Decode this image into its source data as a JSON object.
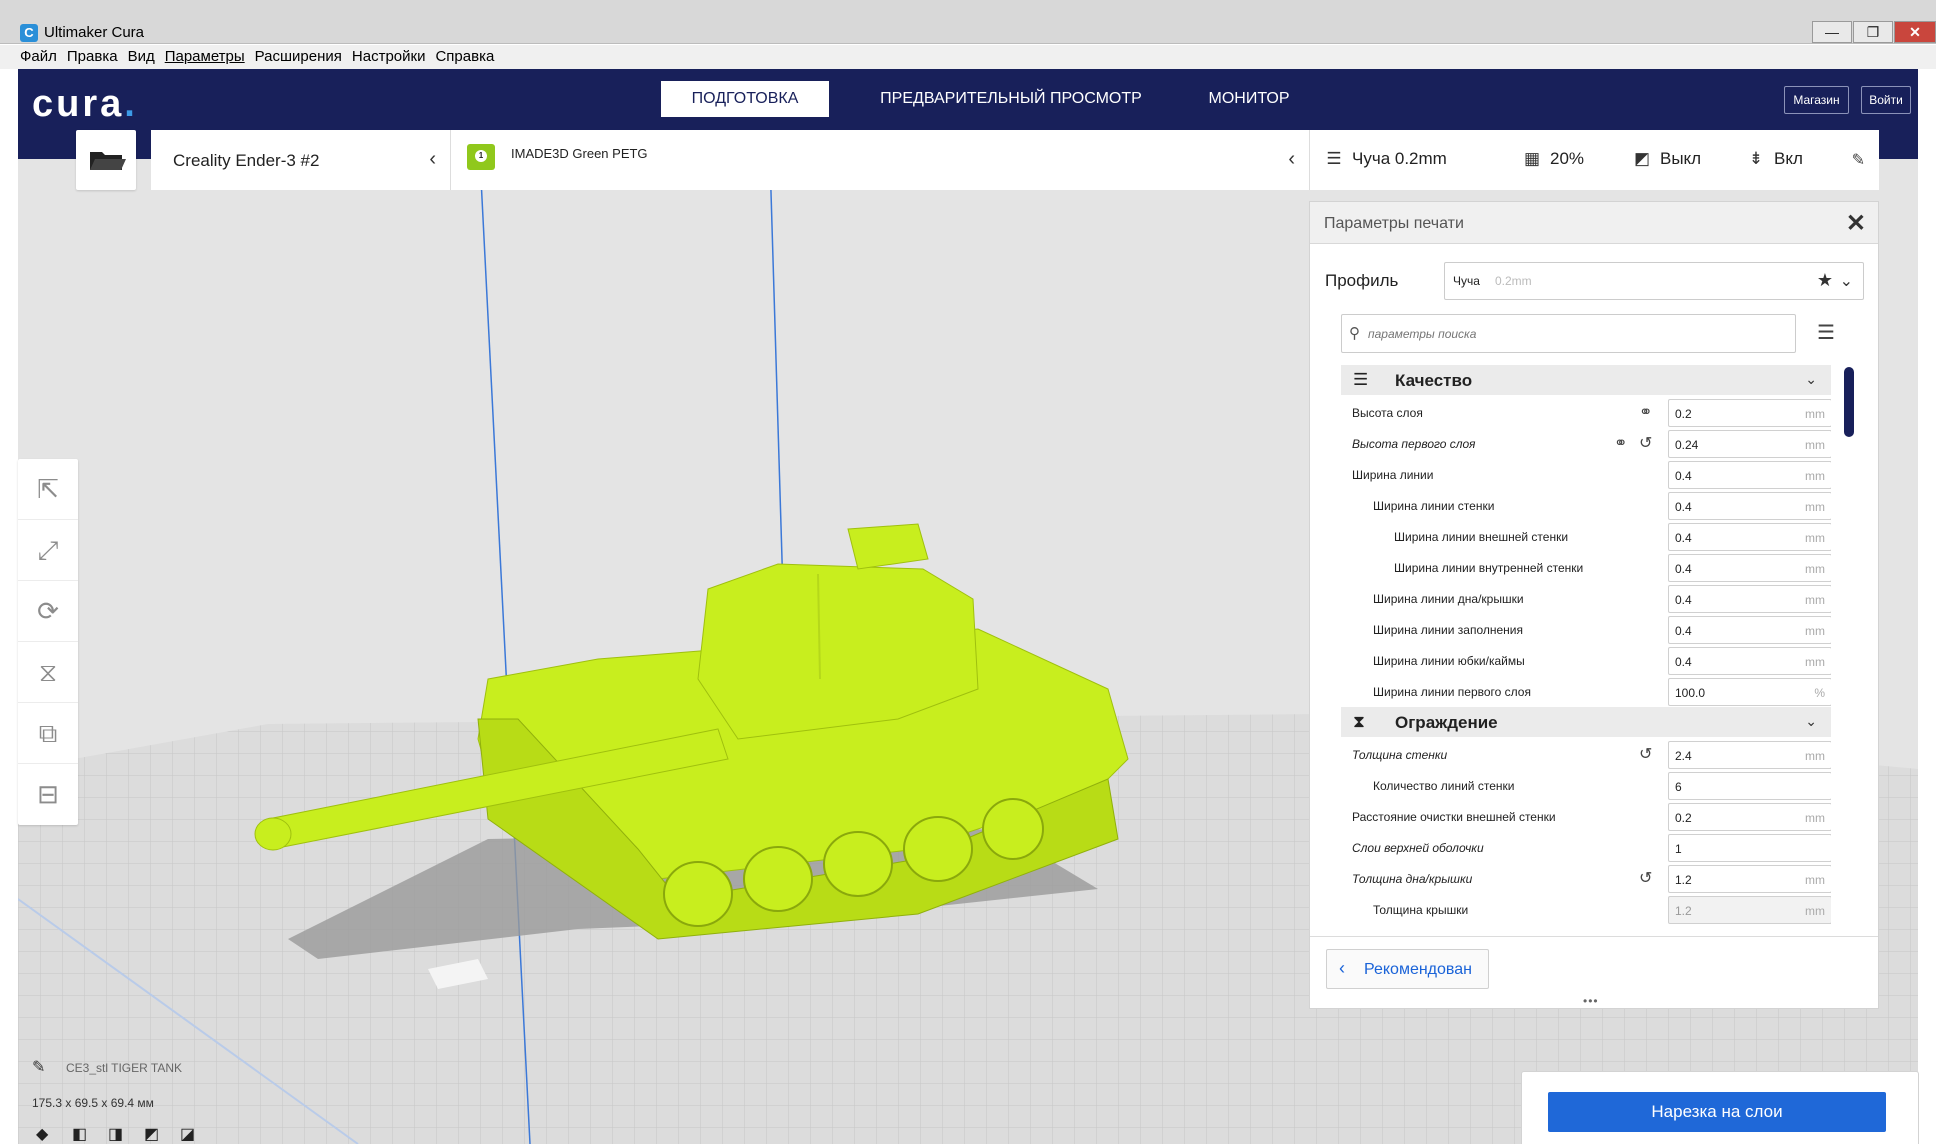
{
  "window": {
    "title": "Ultimaker Cura",
    "logo_letter": "C",
    "minimize": "—",
    "maximize": "❐",
    "close": "✕"
  },
  "menu": [
    "Файл",
    "Правка",
    "Вид",
    "Параметры",
    "Расширения",
    "Настройки",
    "Справка"
  ],
  "header": {
    "logo": "cura",
    "logo_dot": ".",
    "tabs": [
      "ПОДГОТОВКА",
      "ПРЕДВАРИТЕЛЬНЫЙ ПРОСМОТР",
      "МОНИТОР"
    ],
    "active_tab": "ПОДГОТОВКА",
    "market": "Магазин",
    "login": "Войти"
  },
  "toolbar": {
    "printer": "Creality Ender-3 #2",
    "extruder_number": "1",
    "material": "IMADE3D Green PETG",
    "profile": "Чуча 0.2mm",
    "infill": "20%",
    "support": "Выкл",
    "adhesion": "Вкл"
  },
  "panel": {
    "title": "Параметры печати",
    "profile_label": "Профиль",
    "profile_name": "Чуча",
    "profile_layer": "0.2mm",
    "search_placeholder": "параметры поиска",
    "recommended": "Рекомендован",
    "dots": "•••"
  },
  "settings": [
    {
      "type": "category",
      "name": "Качество",
      "icon": "quality-icon"
    },
    {
      "type": "row",
      "label": "Высота слоя",
      "value": "0.2",
      "unit": "mm",
      "indent": 0,
      "link": true
    },
    {
      "type": "row",
      "label": "Высота первого слоя",
      "value": "0.24",
      "unit": "mm",
      "indent": 0,
      "italic": true,
      "link": true,
      "reset": true
    },
    {
      "type": "row",
      "label": "Ширина линии",
      "value": "0.4",
      "unit": "mm",
      "indent": 0
    },
    {
      "type": "row",
      "label": "Ширина линии стенки",
      "value": "0.4",
      "unit": "mm",
      "indent": 1
    },
    {
      "type": "row",
      "label": "Ширина линии внешней стенки",
      "value": "0.4",
      "unit": "mm",
      "indent": 2
    },
    {
      "type": "row",
      "label": "Ширина линии внутренней стенки",
      "value": "0.4",
      "unit": "mm",
      "indent": 2
    },
    {
      "type": "row",
      "label": "Ширина линии дна/крышки",
      "value": "0.4",
      "unit": "mm",
      "indent": 1
    },
    {
      "type": "row",
      "label": "Ширина линии заполнения",
      "value": "0.4",
      "unit": "mm",
      "indent": 1
    },
    {
      "type": "row",
      "label": "Ширина линии юбки/каймы",
      "value": "0.4",
      "unit": "mm",
      "indent": 1
    },
    {
      "type": "row",
      "label": "Ширина линии первого слоя",
      "value": "100.0",
      "unit": "%",
      "indent": 1
    },
    {
      "type": "category",
      "name": "Ограждение",
      "icon": "shell-icon"
    },
    {
      "type": "row",
      "label": "Толщина стенки",
      "value": "2.4",
      "unit": "mm",
      "indent": 0,
      "italic": true,
      "reset": true
    },
    {
      "type": "row",
      "label": "Количество линий стенки",
      "value": "6",
      "unit": "",
      "indent": 1
    },
    {
      "type": "row",
      "label": "Расстояние очистки внешней стенки",
      "value": "0.2",
      "unit": "mm",
      "indent": 0
    },
    {
      "type": "row",
      "label": "Слои верхней оболочки",
      "value": "1",
      "unit": "",
      "indent": 0,
      "italic": true
    },
    {
      "type": "row",
      "label": "Толщина дна/крышки",
      "value": "1.2",
      "unit": "mm",
      "indent": 0,
      "italic": true,
      "reset": true
    },
    {
      "type": "row",
      "label": "Толщина крышки",
      "value": "1.2",
      "unit": "mm",
      "indent": 1,
      "disabled": true
    }
  ],
  "object": {
    "name": "CE3_stl TIGER TANK",
    "dims": "175.3 x 69.5 x 69.4 мм"
  },
  "slice": {
    "label": "Нарезка на слои"
  },
  "colors": {
    "header": "#18205a",
    "accent": "#1f68d8",
    "model": "#c8ee1e"
  }
}
